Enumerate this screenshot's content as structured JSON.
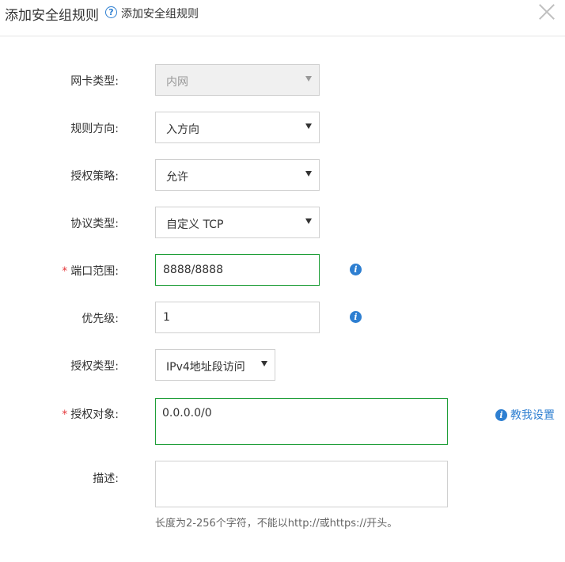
{
  "dialog": {
    "title": "添加安全组规则",
    "help_label": "添加安全组规则",
    "help_icon": "?"
  },
  "form": {
    "nic_type": {
      "label": "网卡类型:",
      "value": "内网"
    },
    "direction": {
      "label": "规则方向:",
      "value": "入方向"
    },
    "policy": {
      "label": "授权策略:",
      "value": "允许"
    },
    "protocol": {
      "label": "协议类型:",
      "value": "自定义 TCP"
    },
    "port_range": {
      "label": "端口范围:",
      "required": "*",
      "value": "8888/8888"
    },
    "priority": {
      "label": "优先级:",
      "value": "1"
    },
    "auth_type": {
      "label": "授权类型:",
      "value": "IPv4地址段访问"
    },
    "auth_object": {
      "label": "授权对象:",
      "required": "*",
      "value": "0.0.0.0/0",
      "help_link": "教我设置"
    },
    "description": {
      "label": "描述:",
      "value": "",
      "hint": "长度为2-256个字符，不能以http://或https://开头。"
    }
  },
  "icons": {
    "info": "i"
  },
  "colors": {
    "accent": "#2e7fd1",
    "focus_border": "#1f9e38",
    "required": "#e4393c"
  }
}
